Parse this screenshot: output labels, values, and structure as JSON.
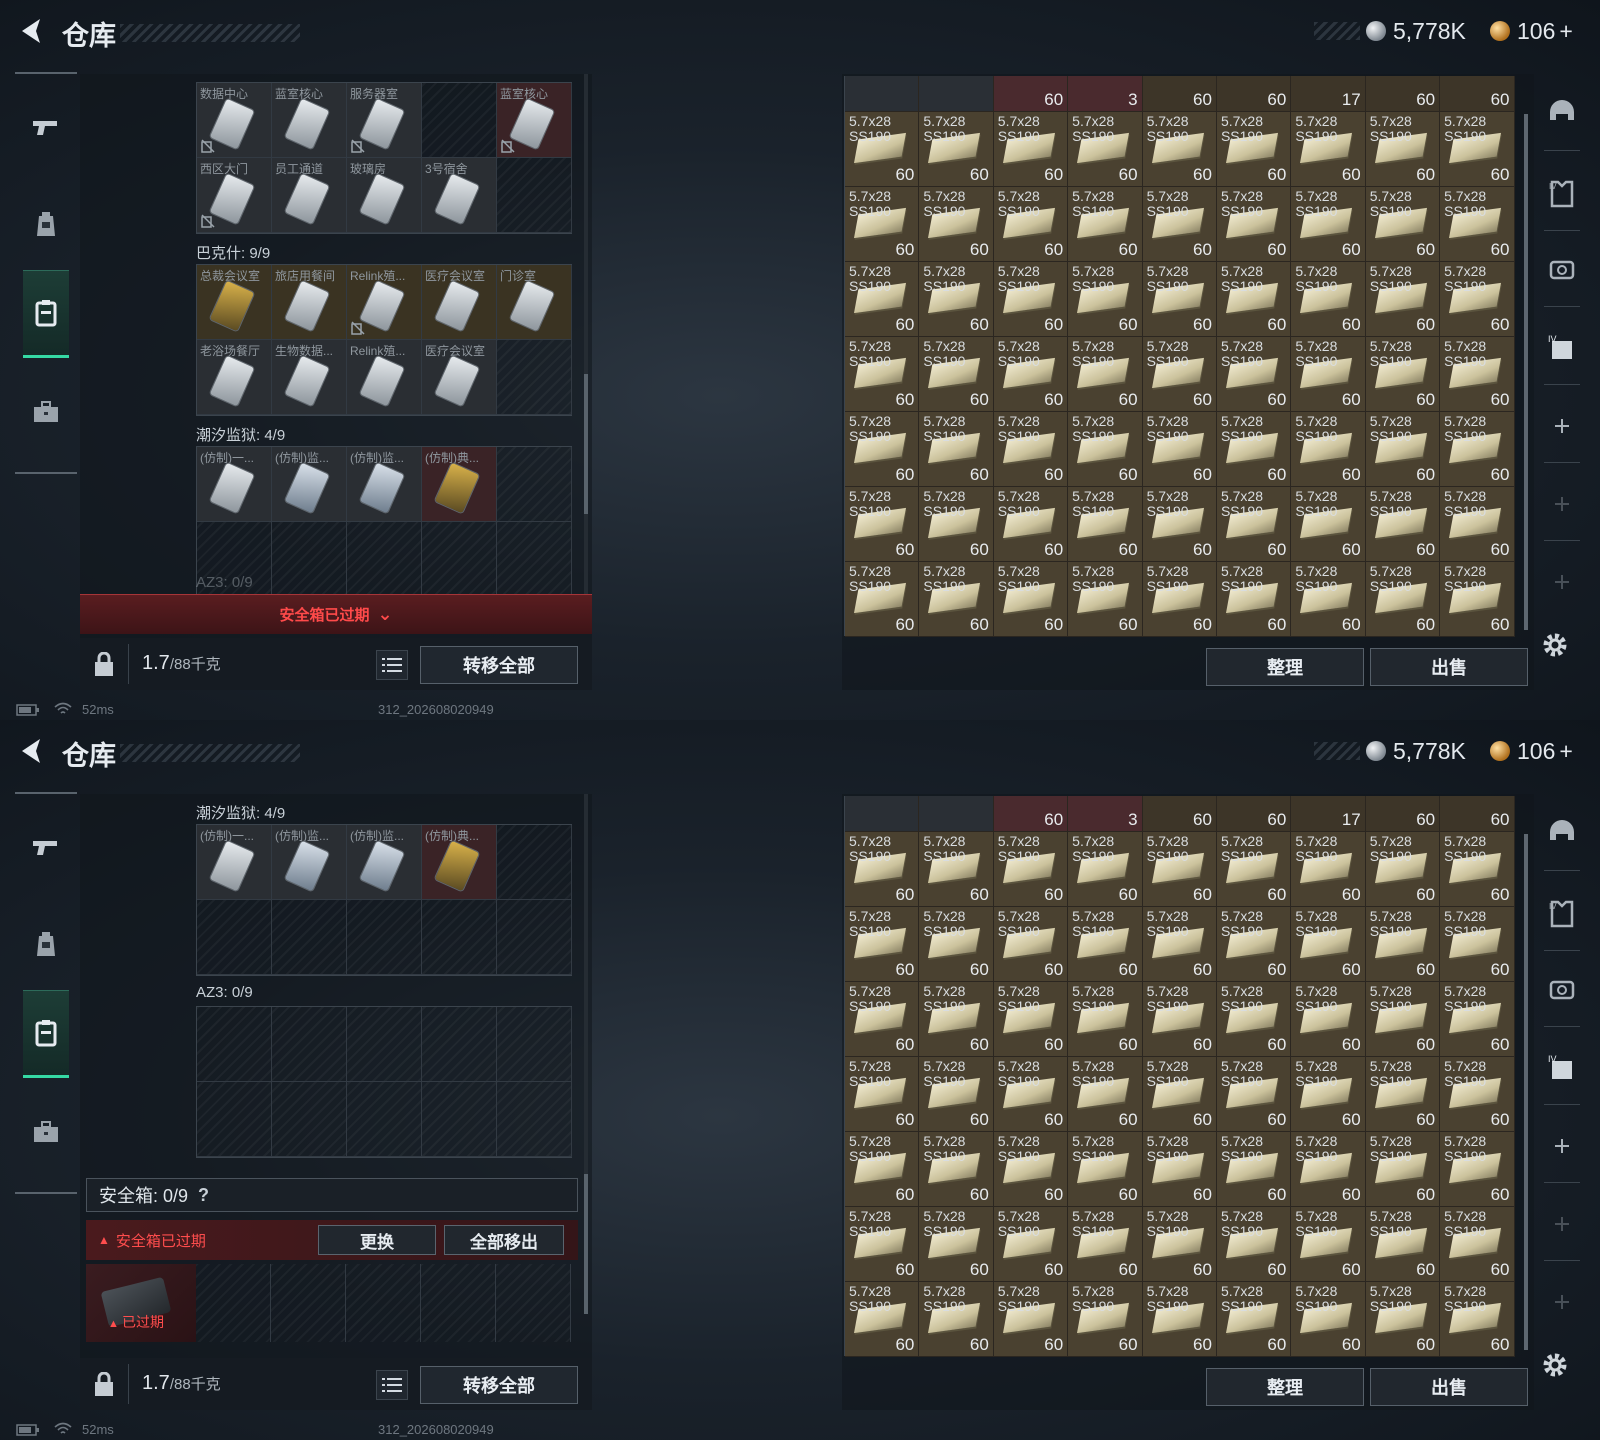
{
  "header": {
    "title": "仓库",
    "silver": "5,778K",
    "gold": "106",
    "gold_plus": "+"
  },
  "colors": {
    "accent_green": "#35d9a4",
    "warning_red": "#ff4a4a",
    "ammo_tile": "#4a4130"
  },
  "nav": [
    "pistol-icon",
    "backpack-icon",
    "locker-icon",
    "briefcase-icon"
  ],
  "screens": [
    {
      "groups": [
        {
          "label": "",
          "cells": [
            {
              "text": "数据中心",
              "tone": "filled",
              "card": "white",
              "broken": true
            },
            {
              "text": "蓝室核心",
              "tone": "filled",
              "card": "white",
              "broken": false
            },
            {
              "text": "服务器室",
              "tone": "filled",
              "card": "white",
              "broken": true
            },
            {
              "text": "",
              "tone": "empty",
              "card": "",
              "broken": false
            },
            {
              "text": "蓝室核心",
              "tone": "red",
              "card": "white",
              "broken": true
            },
            {
              "text": "西区大门",
              "tone": "filled",
              "card": "white",
              "broken": true
            },
            {
              "text": "员工通道",
              "tone": "filled",
              "card": "white",
              "broken": false
            },
            {
              "text": "玻璃房",
              "tone": "filled",
              "card": "white",
              "broken": false
            },
            {
              "text": "3号宿舍",
              "tone": "filled",
              "card": "white",
              "broken": false
            },
            {
              "text": "",
              "tone": "empty",
              "card": "",
              "broken": false
            }
          ]
        },
        {
          "label": "巴克什: 9/9",
          "cells": [
            {
              "text": "总裁会议室",
              "tone": "gold",
              "card": "gold",
              "broken": false
            },
            {
              "text": "旅店用餐间",
              "tone": "gold",
              "card": "white",
              "broken": false
            },
            {
              "text": "Relink殖...",
              "tone": "gold",
              "card": "white",
              "broken": true
            },
            {
              "text": "医疗会议室",
              "tone": "gold",
              "card": "white",
              "broken": false
            },
            {
              "text": "门诊室",
              "tone": "gold",
              "card": "white",
              "broken": false
            },
            {
              "text": "老浴场餐厅",
              "tone": "filled",
              "card": "white",
              "broken": false
            },
            {
              "text": "生物数据...",
              "tone": "filled",
              "card": "white",
              "broken": false
            },
            {
              "text": "Relink殖...",
              "tone": "filled",
              "card": "white",
              "broken": false
            },
            {
              "text": "医疗会议室",
              "tone": "filled",
              "card": "white",
              "broken": false
            },
            {
              "text": "",
              "tone": "empty",
              "card": "",
              "broken": false
            }
          ]
        },
        {
          "label": "潮汐监狱: 4/9",
          "cells": [
            {
              "text": "(仿制)一...",
              "tone": "filled",
              "card": "white",
              "broken": false
            },
            {
              "text": "(仿制)监...",
              "tone": "filled",
              "card": "blue",
              "broken": false
            },
            {
              "text": "(仿制)监...",
              "tone": "filled",
              "card": "blue",
              "broken": false
            },
            {
              "text": "(仿制)典...",
              "tone": "red",
              "card": "gold",
              "broken": false
            },
            {
              "text": "",
              "tone": "empty",
              "card": "",
              "broken": false
            },
            {
              "text": "",
              "tone": "empty",
              "card": "",
              "broken": false
            },
            {
              "text": "",
              "tone": "empty",
              "card": "",
              "broken": false
            },
            {
              "text": "",
              "tone": "empty",
              "card": "",
              "broken": false
            },
            {
              "text": "",
              "tone": "empty",
              "card": "",
              "broken": false
            },
            {
              "text": "",
              "tone": "empty",
              "card": "",
              "broken": false
            }
          ]
        }
      ],
      "expired_bar": "安全箱已过期",
      "peek_label": "AZ3: 0/9"
    },
    {
      "groups": [
        {
          "label": "潮汐监狱: 4/9",
          "cells": [
            {
              "text": "(仿制)一...",
              "tone": "filled",
              "card": "white",
              "broken": false
            },
            {
              "text": "(仿制)监...",
              "tone": "filled",
              "card": "blue",
              "broken": false
            },
            {
              "text": "(仿制)监...",
              "tone": "filled",
              "card": "blue",
              "broken": false
            },
            {
              "text": "(仿制)典...",
              "tone": "red",
              "card": "gold",
              "broken": false
            },
            {
              "text": "",
              "tone": "empty",
              "card": "",
              "broken": false
            },
            {
              "text": "",
              "tone": "empty",
              "card": "",
              "broken": false
            },
            {
              "text": "",
              "tone": "empty",
              "card": "",
              "broken": false
            },
            {
              "text": "",
              "tone": "empty",
              "card": "",
              "broken": false
            },
            {
              "text": "",
              "tone": "empty",
              "card": "",
              "broken": false
            },
            {
              "text": "",
              "tone": "empty",
              "card": "",
              "broken": false
            }
          ]
        },
        {
          "label": "AZ3: 0/9",
          "cells": [
            {
              "text": "",
              "tone": "empty",
              "card": "",
              "broken": false
            },
            {
              "text": "",
              "tone": "empty",
              "card": "",
              "broken": false
            },
            {
              "text": "",
              "tone": "empty",
              "card": "",
              "broken": false
            },
            {
              "text": "",
              "tone": "empty",
              "card": "",
              "broken": false
            },
            {
              "text": "",
              "tone": "empty",
              "card": "",
              "broken": false
            },
            {
              "text": "",
              "tone": "empty",
              "card": "",
              "broken": false
            },
            {
              "text": "",
              "tone": "empty",
              "card": "",
              "broken": false
            },
            {
              "text": "",
              "tone": "empty",
              "card": "",
              "broken": false
            },
            {
              "text": "",
              "tone": "empty",
              "card": "",
              "broken": false
            },
            {
              "text": "",
              "tone": "empty",
              "card": "",
              "broken": false
            }
          ]
        }
      ],
      "safebox": {
        "header": "安全箱: 0/9",
        "help": "?",
        "warning": "安全箱已过期",
        "replace_button": "更换",
        "remove_all_button": "全部移出",
        "expired_tag": "已过期"
      }
    }
  ],
  "weight": {
    "current": "1.7",
    "max": "/88千克",
    "transfer_all": "转移全部"
  },
  "stash": {
    "top_row_counts": [
      "",
      "",
      "60",
      "3",
      "60",
      "60",
      "17",
      "60",
      "60"
    ],
    "ammo_name": "5.7x28\nSS190",
    "ammo_count": "60",
    "rows": 7,
    "cols": 9,
    "sort_button": "整理",
    "sell_button": "出售"
  },
  "tools": [
    "helmet-icon",
    "armor-icon",
    "chest-rig-icon",
    "backpack-tier-icon",
    "add-icon",
    "add-icon",
    "add-icon"
  ],
  "status": {
    "ping": "52ms",
    "build": "312_202608020949"
  }
}
